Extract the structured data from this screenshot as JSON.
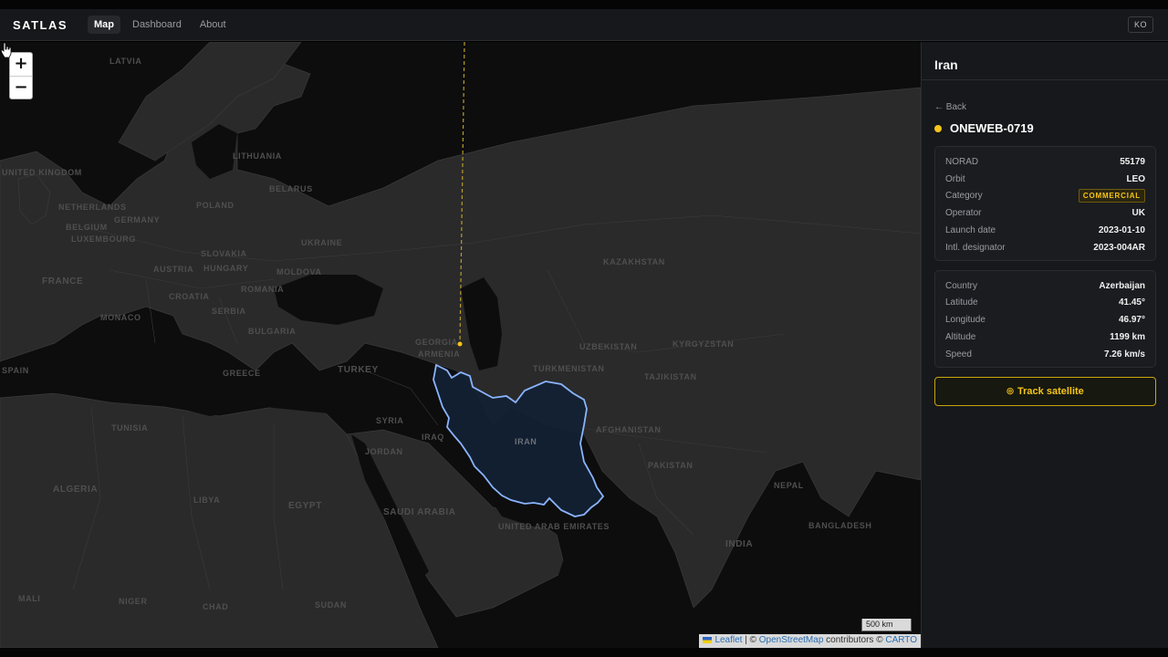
{
  "app": {
    "logo": "SATLAS",
    "lang": "KO"
  },
  "nav": [
    {
      "label": "Map",
      "active": true
    },
    {
      "label": "Dashboard",
      "active": false
    },
    {
      "label": "About",
      "active": false
    }
  ],
  "map": {
    "zoom_in": "+",
    "zoom_out": "−",
    "scale": "500 km",
    "attribution": {
      "leaflet": "Leaflet",
      "sep1": "| ©",
      "osm": "OpenStreetMap",
      "mid": "contributors ©",
      "carto": "CARTO"
    },
    "country_labels": [
      "LATVIA",
      "LITHUANIA",
      "BELARUS",
      "POLAND",
      "GERMANY",
      "NETHERLANDS",
      "BELGIUM",
      "LUXEMBOURG",
      "UKRAINE",
      "SLOVAKIA",
      "AUSTRIA",
      "HUNGARY",
      "MOLDOVA",
      "ROMANIA",
      "SERBIA",
      "CROATIA",
      "FRANCE",
      "MONACO",
      "BULGARIA",
      "GREECE",
      "TURKEY",
      "KAZAKHSTAN",
      "UZBEKISTAN",
      "KYRGYZSTAN",
      "TURKMENISTAN",
      "TAJIKISTAN",
      "AFGHANISTAN",
      "PAKISTAN",
      "IRAN",
      "IRAQ",
      "SYRIA",
      "JORDAN",
      "EGYPT",
      "LIBYA",
      "ALGERIA",
      "TUNISIA",
      "SAUDI ARABIA",
      "UNITED ARAB EMIRATES",
      "INDIA",
      "NEPAL",
      "BANGLADESH",
      "MALI",
      "NIGER",
      "CHAD",
      "SUDAN",
      "SPAIN",
      "UNITED KINGDOM",
      "GEORGIA",
      "ARMENIA"
    ]
  },
  "panel": {
    "title": "Iran",
    "back": "← Back",
    "satellite_name": "ONEWEB-0719",
    "details": [
      {
        "key": "NORAD",
        "value": "55179"
      },
      {
        "key": "Orbit",
        "value": "LEO"
      },
      {
        "key": "Category",
        "value": "COMMERCIAL",
        "badge": true
      },
      {
        "key": "Operator",
        "value": "UK"
      },
      {
        "key": "Launch date",
        "value": "2023-01-10"
      },
      {
        "key": "Intl. designator",
        "value": "2023-004AR"
      }
    ],
    "position": [
      {
        "key": "Country",
        "value": "Azerbaijan"
      },
      {
        "key": "Latitude",
        "value": "41.45°"
      },
      {
        "key": "Longitude",
        "value": "46.97°"
      },
      {
        "key": "Altitude",
        "value": "1199 km"
      },
      {
        "key": "Speed",
        "value": "7.26 km/s"
      }
    ],
    "track_button": "Track satellite",
    "colors": {
      "accent": "#f5c518",
      "highlight_border": "#8ab4ff"
    }
  }
}
